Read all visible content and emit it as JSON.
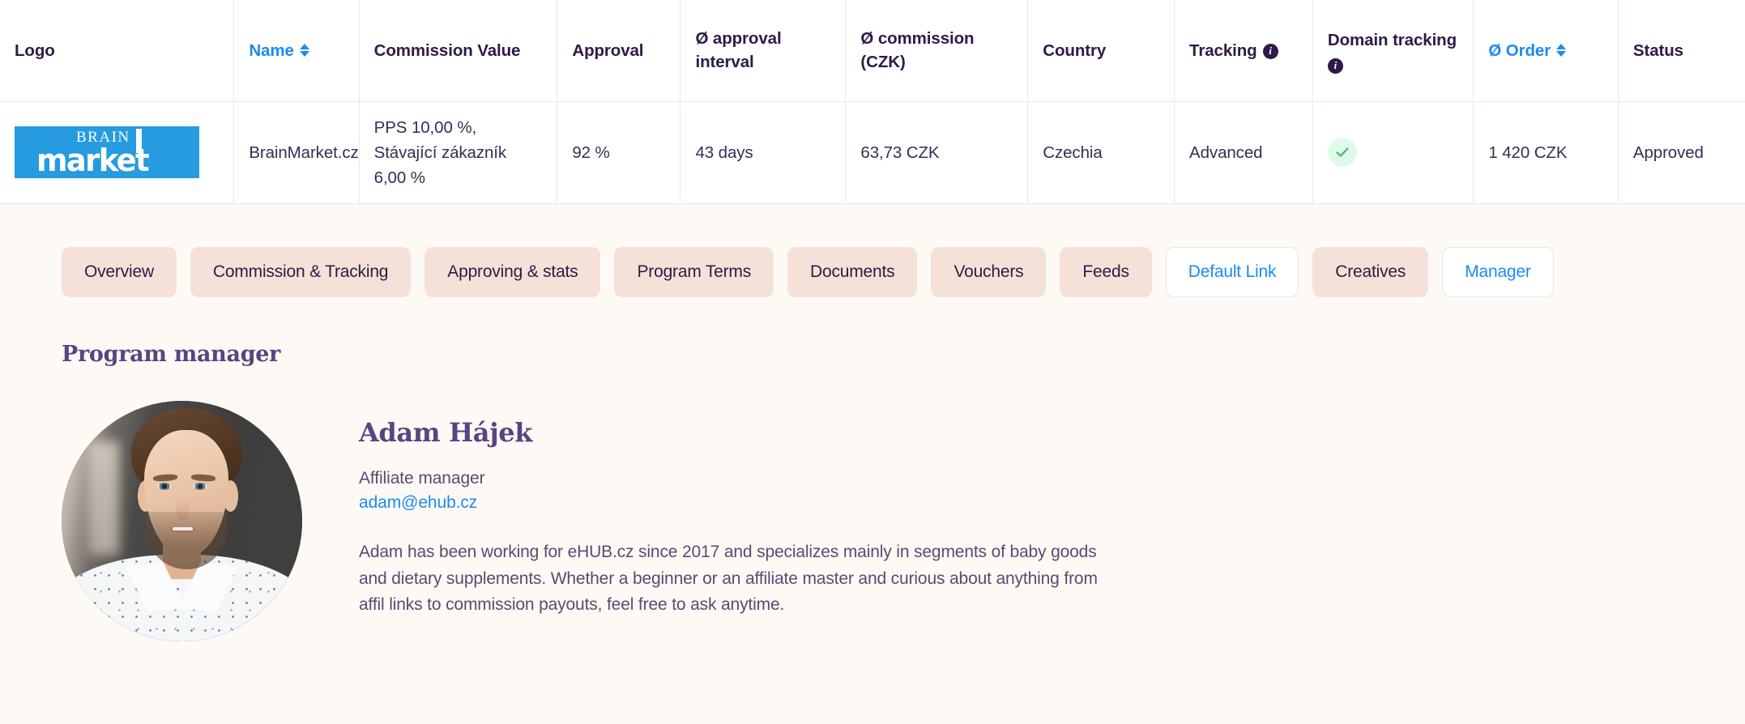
{
  "table": {
    "columns": [
      {
        "key": "logo",
        "label": "Logo",
        "sortable": false,
        "info": false
      },
      {
        "key": "name",
        "label": "Name",
        "sortable": true,
        "info": false
      },
      {
        "key": "commission_value",
        "label": "Commission Value",
        "sortable": false,
        "info": false
      },
      {
        "key": "approval",
        "label": "Approval",
        "sortable": false,
        "info": false
      },
      {
        "key": "approval_interval",
        "label": "Ø approval interval",
        "sortable": false,
        "info": false
      },
      {
        "key": "commission",
        "label": "Ø commission (CZK)",
        "sortable": false,
        "info": false
      },
      {
        "key": "country",
        "label": "Country",
        "sortable": false,
        "info": false
      },
      {
        "key": "tracking",
        "label": "Tracking",
        "sortable": false,
        "info": true
      },
      {
        "key": "domain_tracking",
        "label": "Domain tracking",
        "sortable": false,
        "info": true
      },
      {
        "key": "order",
        "label": "Ø Order",
        "sortable": true,
        "info": false
      },
      {
        "key": "status",
        "label": "Status",
        "sortable": false,
        "info": false
      }
    ],
    "row": {
      "logo_brand_top": "BRAIN",
      "logo_brand_bottom": "market",
      "name": "BrainMarket.cz",
      "commission_value": "PPS 10,00 %, Stávající zákazník 6,00 %",
      "approval": "92 %",
      "approval_interval": "43 days",
      "commission": "63,73 CZK",
      "country": "Czechia",
      "tracking": "Advanced",
      "domain_tracking_icon": "check-icon",
      "order": "1 420 CZK",
      "status": "Approved"
    }
  },
  "tabs": [
    {
      "label": "Overview",
      "style": "muted",
      "selected": false
    },
    {
      "label": "Commission & Tracking",
      "style": "muted",
      "selected": false
    },
    {
      "label": "Approving & stats",
      "style": "muted",
      "selected": false
    },
    {
      "label": "Program Terms",
      "style": "muted",
      "selected": false
    },
    {
      "label": "Documents",
      "style": "muted",
      "selected": false
    },
    {
      "label": "Vouchers",
      "style": "muted",
      "selected": false
    },
    {
      "label": "Feeds",
      "style": "muted",
      "selected": false
    },
    {
      "label": "Default Link",
      "style": "light",
      "selected": false
    },
    {
      "label": "Creatives",
      "style": "muted",
      "selected": false
    },
    {
      "label": "Manager",
      "style": "light",
      "selected": true
    }
  ],
  "manager_section": {
    "title": "Program manager",
    "name": "Adam Hájek",
    "role": "Affiliate manager",
    "email": "adam@ehub.cz",
    "bio": "Adam has been working for eHUB.cz since 2017 and specializes mainly in segments of baby goods and dietary supplements. Whether a beginner or an affiliate master and curious about anything from affil links to commission payouts, feel free to ask anytime."
  },
  "colors": {
    "page_background": "#FDFAF6",
    "table_background": "#FFFFFF",
    "accent_link": "#1B8BF0",
    "heading_purple": "#5B4380",
    "text_dark": "#2E1A47",
    "tab_muted": "#F6E1D8",
    "logo_blue": "#269BE0",
    "check_green": "#4CB97B",
    "check_badge_background": "#DFFAEA"
  }
}
